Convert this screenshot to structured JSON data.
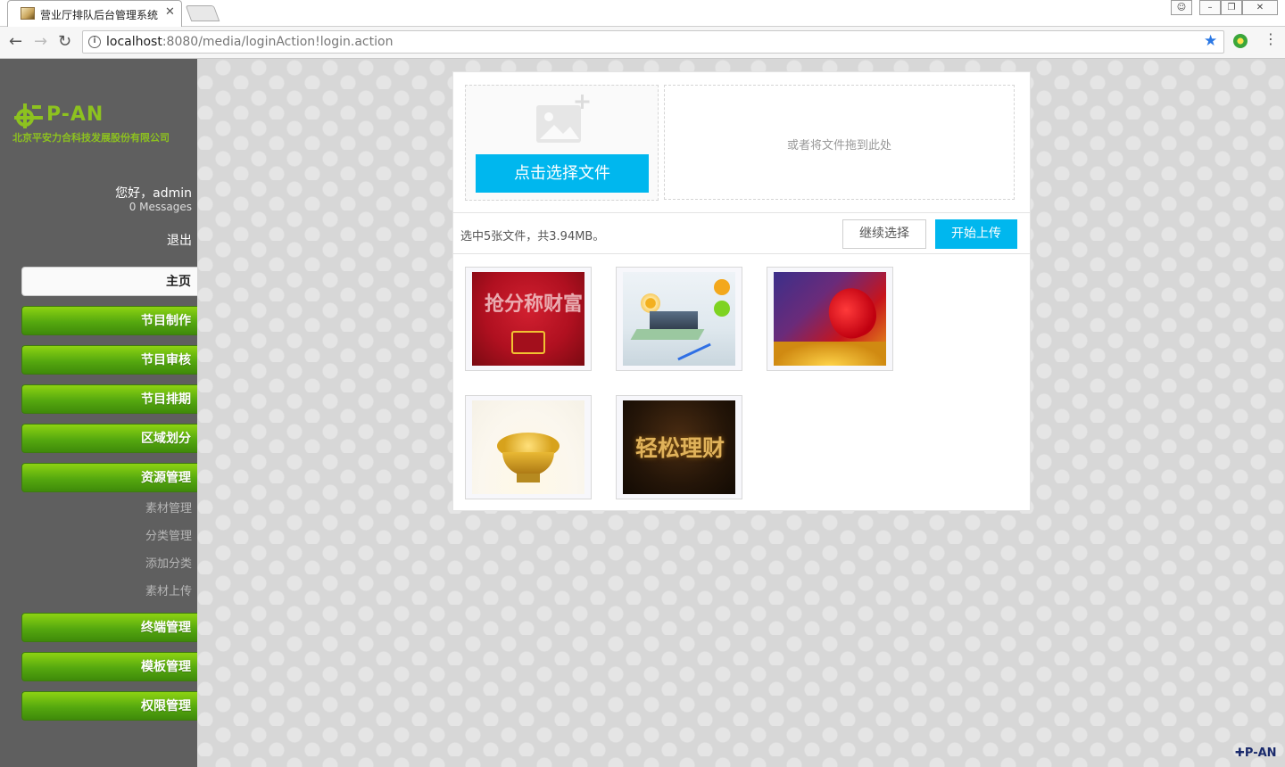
{
  "browser": {
    "tab_title": "营业厅排队后台管理系统",
    "url_host": "localhost",
    "url_rest": ":8080/media/loginAction!login.action"
  },
  "sidebar": {
    "logo_text": "P-AN",
    "company": "北京平安力合科技发展股份有限公司",
    "greeting": "您好，admin",
    "messages": "0 Messages",
    "logout": "退出",
    "home": "主页",
    "menu": [
      "节目制作",
      "节目审核",
      "节目排期",
      "区域划分",
      "资源管理"
    ],
    "submenu": [
      "素材管理",
      "分类管理",
      "添加分类",
      "素材上传"
    ],
    "menu_bottom": [
      "终端管理",
      "模板管理",
      "权限管理"
    ]
  },
  "upload": {
    "pick_button": "点击选择文件",
    "drop_hint": "或者将文件拖到此处",
    "status": "选中5张文件，共3.94MB。",
    "continue_button": "继续选择",
    "start_button": "开始上传"
  },
  "thumbnails": [
    {
      "name": "thumb-1",
      "art": "抢分称财富"
    },
    {
      "name": "thumb-2",
      "art": ""
    },
    {
      "name": "thumb-3",
      "art": ""
    },
    {
      "name": "thumb-4",
      "art": ""
    },
    {
      "name": "thumb-5",
      "art": "轻松理财"
    }
  ],
  "footer": {
    "brand": "P-AN"
  },
  "colors": {
    "accent_blue": "#00b7ee",
    "menu_green": "#55a80f",
    "sidebar_bg": "#5f5f5f",
    "logo_green": "#8dc21f"
  }
}
